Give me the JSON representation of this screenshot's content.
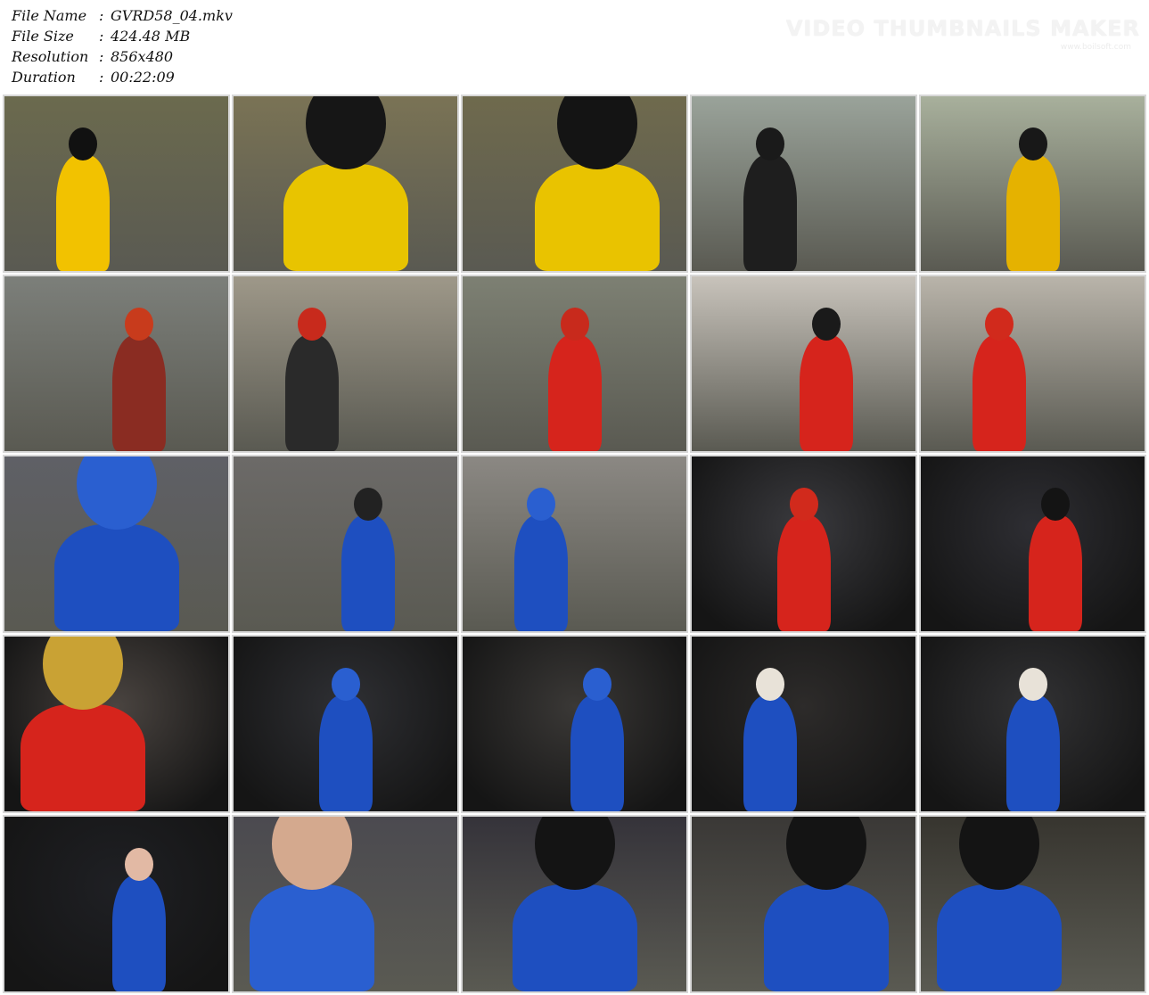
{
  "file_info": {
    "rows": [
      {
        "label": "File Name",
        "sep": ":",
        "value": "GVRD58_04.mkv"
      },
      {
        "label": "File Size",
        "sep": ":",
        "value": "424.48 MB"
      },
      {
        "label": "Resolution",
        "sep": ":",
        "value": "856x480"
      },
      {
        "label": "Duration",
        "sep": ":",
        "value": "00:22:09"
      }
    ]
  },
  "watermark": {
    "title": "VIDEO THUMBNAILS MAKER",
    "subtitle": "www.boilsoft.com"
  },
  "thumbnails": [
    {
      "bg": "#6b6a4e",
      "accent": "#f2c200",
      "hair": "#111111",
      "scene": "park"
    },
    {
      "bg": "#7a7355",
      "accent": "#e8c400",
      "hair": "#161616",
      "scene": "park-closeup"
    },
    {
      "bg": "#6f6a4d",
      "accent": "#e9c300",
      "hair": "#141414",
      "scene": "park-closeup"
    },
    {
      "bg": "#9aa39a",
      "accent": "#1e1e1e",
      "hair": "#1a1a1a",
      "scene": "playground"
    },
    {
      "bg": "#a8b09c",
      "accent": "#e5b200",
      "hair": "#181818",
      "scene": "playground"
    },
    {
      "bg": "#7c7f7a",
      "accent": "#8a2c22",
      "hair": "#c83b1c",
      "scene": "street"
    },
    {
      "bg": "#9e9889",
      "accent": "#2a2a2a",
      "hair": "#c82a1c",
      "scene": "street"
    },
    {
      "bg": "#7d8073",
      "accent": "#d6241c",
      "hair": "#c82a1c",
      "scene": "street"
    },
    {
      "bg": "#c8c3bb",
      "accent": "#d6241c",
      "hair": "#1a1a1a",
      "scene": "studio"
    },
    {
      "bg": "#b9b4aa",
      "accent": "#d6241c",
      "hair": "#d12a1c",
      "scene": "studio"
    },
    {
      "bg": "#5f6066",
      "accent": "#1e4fc0",
      "hair": "#2a5fd0",
      "scene": "suit-closeup"
    },
    {
      "bg": "#6c6a68",
      "accent": "#1e4fc0",
      "hair": "#222222",
      "scene": "set"
    },
    {
      "bg": "#8b8883",
      "accent": "#1e4fc0",
      "hair": "#2a5fd0",
      "scene": "set"
    },
    {
      "bg": "#3a3a3e",
      "accent": "#d6241c",
      "hair": "#d12a1c",
      "scene": "lab"
    },
    {
      "bg": "#2e2e33",
      "accent": "#d6241c",
      "hair": "#141414",
      "scene": "lab"
    },
    {
      "bg": "#4a4440",
      "accent": "#d6241c",
      "hair": "#c9a234",
      "scene": "lab-closeup"
    },
    {
      "bg": "#2f3034",
      "accent": "#1e4fc0",
      "hair": "#2a5fd0",
      "scene": "lab-dark"
    },
    {
      "bg": "#3a3836",
      "accent": "#1e4fc0",
      "hair": "#2a5fd0",
      "scene": "lab-dark"
    },
    {
      "bg": "#2d2b2a",
      "accent": "#1e4fc0",
      "hair": "#e8e2d8",
      "scene": "floor"
    },
    {
      "bg": "#323234",
      "accent": "#1e4fc0",
      "hair": "#e8e2d8",
      "scene": "floor"
    },
    {
      "bg": "#1f2024",
      "accent": "#1e4fc0",
      "hair": "#e2b9a4",
      "scene": "floor-dark"
    },
    {
      "bg": "#4b4a50",
      "accent": "#2a5fd0",
      "hair": "#d4a98e",
      "scene": "closeup"
    },
    {
      "bg": "#35333a",
      "accent": "#1e4fc0",
      "hair": "#141414",
      "scene": "portrait"
    },
    {
      "bg": "#3a3836",
      "accent": "#1e4fc0",
      "hair": "#141414",
      "scene": "portrait"
    },
    {
      "bg": "#37352f",
      "accent": "#1e4fc0",
      "hair": "#141414",
      "scene": "portrait"
    }
  ]
}
